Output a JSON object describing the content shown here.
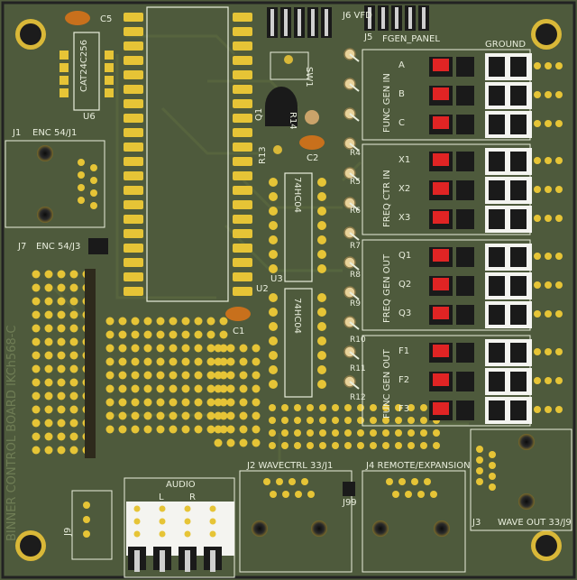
{
  "board": {
    "title": "BINNER CONTROL BOARD IKCh568-C",
    "colors": {
      "mask": "#4e5a3c",
      "silk": "#e9eedd",
      "pad": "#e6c436",
      "red": "#e02424",
      "header": "#1a1a1a",
      "cap": "#c8701c"
    }
  },
  "headers": {
    "j6": "J6 VFD",
    "j5": "J5",
    "fgen_panel": "FGEN_PANEL",
    "ground": "GROUND",
    "j1": "J1",
    "enc54_j1": "ENC 54/J1",
    "j7": "J7",
    "enc54_j3": "ENC 54/J3",
    "j2": "J2 WAVECTRL 33/J1",
    "j4": "J4 REMOTE/EXPANSION",
    "j3": "J3",
    "wave_out": "WAVE OUT 33/J9",
    "j99": "J99",
    "j9": "J9",
    "audio": "AUDIO",
    "audio_l": "L",
    "audio_r": "R"
  },
  "components": {
    "c5": "C5",
    "c1": "C1",
    "c2": "C2",
    "u6_part": "CAT24C256",
    "u6": "U6",
    "u2": "U2",
    "u3": "U3",
    "u3_part": "74HC04",
    "u3b_part": "74HC04",
    "q1": "Q1",
    "sw1": "SW1",
    "r13": "R13",
    "r14": "R14",
    "r4": "R4",
    "r5": "R5",
    "r6": "R6",
    "r7": "R7",
    "r8": "R8",
    "r9": "R9",
    "r10": "R10",
    "r11": "R11",
    "r12": "R12"
  },
  "groups": [
    {
      "label": "FUNC GEN IN",
      "rows": [
        "A",
        "B",
        "C"
      ]
    },
    {
      "label": "FREQ CTR IN",
      "rows": [
        "X1",
        "X2",
        "X3"
      ]
    },
    {
      "label": "FREQ GEN OUT",
      "rows": [
        "Q1",
        "Q2",
        "Q3"
      ]
    },
    {
      "label": "FUNC GEN OUT",
      "rows": [
        "F1",
        "F2",
        "F3"
      ]
    }
  ]
}
